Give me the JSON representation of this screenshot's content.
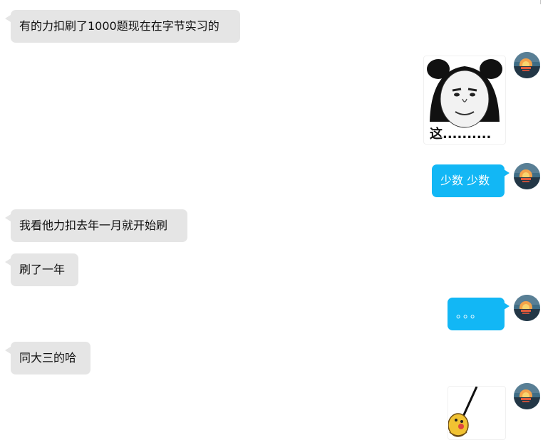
{
  "messages": [
    {
      "text": "有的力扣刷了1000题现在在字节实习的"
    },
    {
      "sticker_caption": "这..........",
      "sticker_icon": "panda-face-meme"
    },
    {
      "text": "少数 少数"
    },
    {
      "text": "我看他力扣去年一月就开始刷"
    },
    {
      "text": "刷了一年"
    },
    {
      "text": "。。。"
    },
    {
      "text": "同大三的哈"
    },
    {
      "sticker_icon": "yellow-cartoon-character"
    }
  ],
  "colors": {
    "incoming_bubble": "#e5e5e5",
    "outgoing_bubble": "#12b7f5"
  }
}
